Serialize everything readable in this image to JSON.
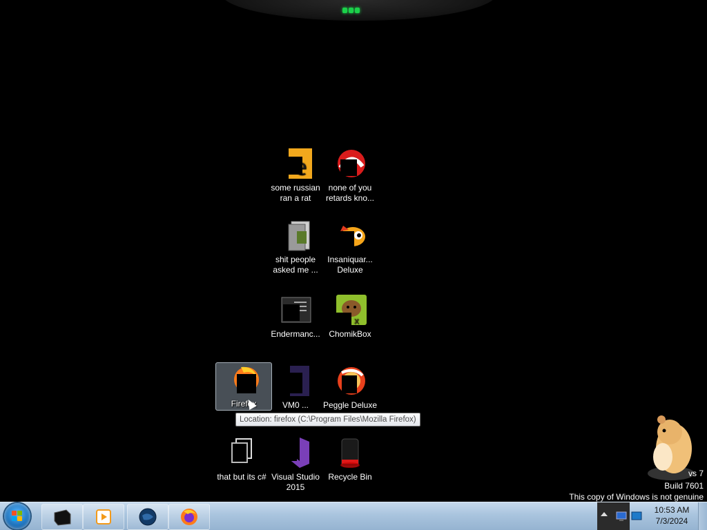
{
  "desktop": {
    "icons": [
      {
        "label": "some russian ran a rat"
      },
      {
        "label": "none of you retards kno..."
      },
      {
        "label": "shit people asked me ..."
      },
      {
        "label": "Insaniquar... Deluxe"
      },
      {
        "label": "Endermanc..."
      },
      {
        "label": "ChomikBox"
      },
      {
        "label": "Firefox"
      },
      {
        "label": "VM0 ..."
      },
      {
        "label": "Peggle Deluxe"
      },
      {
        "label": "that but its c#"
      },
      {
        "label": "Visual Studio 2015"
      },
      {
        "label": "Recycle Bin"
      }
    ],
    "tooltip": "Location: firefox (C:\\Program Files\\Mozilla Firefox)"
  },
  "watermark": {
    "line1": "vs 7",
    "line2": "Build 7601",
    "line3": "This copy of Windows is not genuine"
  },
  "taskbar": {
    "pinned": [
      {
        "name": "media-center-icon"
      },
      {
        "name": "media-player-icon"
      },
      {
        "name": "globe-icon"
      },
      {
        "name": "firefox-icon"
      }
    ],
    "clock": {
      "time": "10:53 AM",
      "date": "7/3/2024"
    }
  },
  "colors": {
    "desktop_bg": "#000000",
    "taskbar_bg": "#a9c4de",
    "accent_green": "#1bd14a"
  }
}
